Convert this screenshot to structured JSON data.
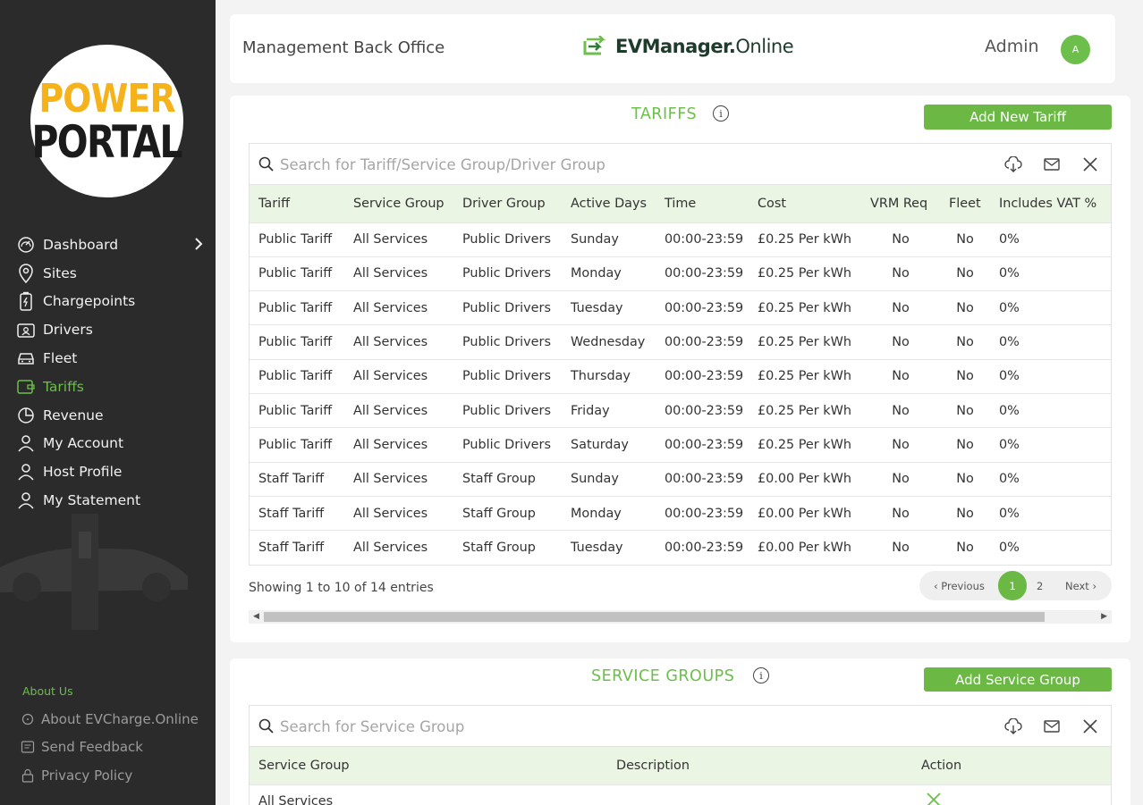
{
  "sidebar": {
    "logo_line1": "POWER",
    "logo_line2": "PORTAL",
    "nav": [
      {
        "label": "Dashboard",
        "icon": "gauge-icon",
        "active": false
      },
      {
        "label": "Sites",
        "icon": "location-pin-icon",
        "active": false
      },
      {
        "label": "Chargepoints",
        "icon": "charger-icon",
        "active": false
      },
      {
        "label": "Drivers",
        "icon": "driver-id-icon",
        "active": false
      },
      {
        "label": "Fleet",
        "icon": "car-icon",
        "active": false
      },
      {
        "label": "Tariffs",
        "icon": "tariff-tag-icon",
        "active": true
      },
      {
        "label": "Revenue",
        "icon": "pie-chart-icon",
        "active": false
      },
      {
        "label": "My Account",
        "icon": "user-icon",
        "active": false
      },
      {
        "label": "Host Profile",
        "icon": "user-icon",
        "active": false
      },
      {
        "label": "My Statement",
        "icon": "user-icon",
        "active": false
      }
    ],
    "about_title": "About Us",
    "about": [
      {
        "label": "About EVCharge.Online",
        "icon": "info-icon"
      },
      {
        "label": "Send Feedback",
        "icon": "feedback-icon"
      },
      {
        "label": "Privacy Policy",
        "icon": "lock-icon"
      }
    ]
  },
  "header": {
    "title": "Management Back Office",
    "brand_bold": "EVManager.",
    "brand_light": "Online",
    "user_name": "Admin",
    "avatar_initial": "A"
  },
  "tariffs": {
    "title": "TARIFFS",
    "add_button": "Add New Tariff",
    "search_placeholder": "Search for Tariff/Service Group/Driver Group",
    "columns": [
      "Tariff",
      "Service Group",
      "Driver Group",
      "Active Days",
      "Time",
      "Cost",
      "VRM Req",
      "Fleet",
      "Includes VAT %"
    ],
    "rows": [
      [
        "Public Tariff",
        "All Services",
        "Public Drivers",
        "Sunday",
        "00:00-23:59",
        "£0.25 Per kWh",
        "No",
        "No",
        "0%"
      ],
      [
        "Public Tariff",
        "All Services",
        "Public Drivers",
        "Monday",
        "00:00-23:59",
        "£0.25 Per kWh",
        "No",
        "No",
        "0%"
      ],
      [
        "Public Tariff",
        "All Services",
        "Public Drivers",
        "Tuesday",
        "00:00-23:59",
        "£0.25 Per kWh",
        "No",
        "No",
        "0%"
      ],
      [
        "Public Tariff",
        "All Services",
        "Public Drivers",
        "Wednesday",
        "00:00-23:59",
        "£0.25 Per kWh",
        "No",
        "No",
        "0%"
      ],
      [
        "Public Tariff",
        "All Services",
        "Public Drivers",
        "Thursday",
        "00:00-23:59",
        "£0.25 Per kWh",
        "No",
        "No",
        "0%"
      ],
      [
        "Public Tariff",
        "All Services",
        "Public Drivers",
        "Friday",
        "00:00-23:59",
        "£0.25 Per kWh",
        "No",
        "No",
        "0%"
      ],
      [
        "Public Tariff",
        "All Services",
        "Public Drivers",
        "Saturday",
        "00:00-23:59",
        "£0.25 Per kWh",
        "No",
        "No",
        "0%"
      ],
      [
        "Staff Tariff",
        "All Services",
        "Staff Group",
        "Sunday",
        "00:00-23:59",
        "£0.00 Per kWh",
        "No",
        "No",
        "0%"
      ],
      [
        "Staff Tariff",
        "All Services",
        "Staff Group",
        "Monday",
        "00:00-23:59",
        "£0.00 Per kWh",
        "No",
        "No",
        "0%"
      ],
      [
        "Staff Tariff",
        "All Services",
        "Staff Group",
        "Tuesday",
        "00:00-23:59",
        "£0.00 Per kWh",
        "No",
        "No",
        "0%"
      ]
    ],
    "showing": "Showing 1 to 10 of 14 entries",
    "pager": {
      "prev": "Previous",
      "current": "1",
      "next_page": "2",
      "next": "Next"
    }
  },
  "service_groups": {
    "title": "SERVICE GROUPS",
    "add_button": "Add Service Group",
    "search_placeholder": "Search for Service Group",
    "columns": [
      "Service Group",
      "Description",
      "Action"
    ],
    "rows": [
      [
        "All Services",
        "",
        ""
      ]
    ]
  },
  "colors": {
    "accent": "#6bbf4a",
    "sidebar": "#2b2b2b",
    "header_row": "#eaf5e4"
  }
}
